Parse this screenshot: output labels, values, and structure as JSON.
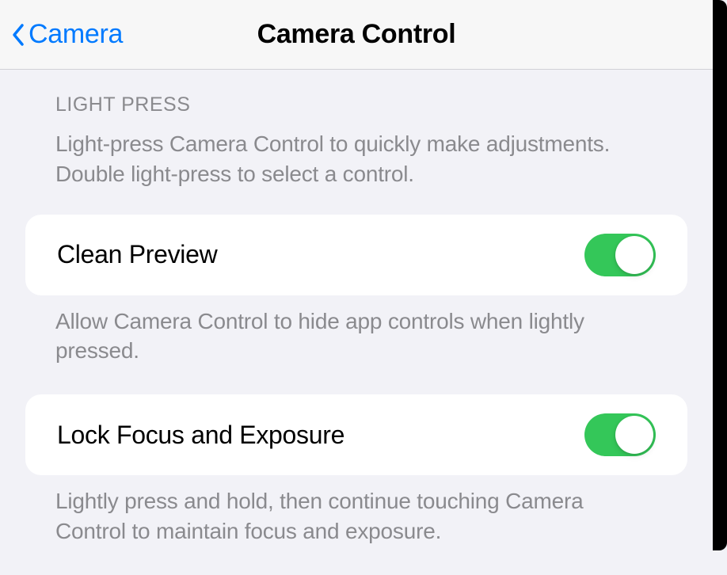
{
  "navbar": {
    "back_label": "Camera",
    "title": "Camera Control"
  },
  "sections": {
    "light_press": {
      "header": "LIGHT PRESS",
      "description": "Light-press Camera Control to quickly make adjustments. Double light-press to select a control."
    }
  },
  "settings": {
    "clean_preview": {
      "label": "Clean Preview",
      "enabled": true,
      "footer": "Allow Camera Control to hide app controls when lightly pressed."
    },
    "lock_focus": {
      "label": "Lock Focus and Exposure",
      "enabled": true,
      "footer": "Lightly press and hold, then continue touching Camera Control to maintain focus and exposure."
    }
  }
}
